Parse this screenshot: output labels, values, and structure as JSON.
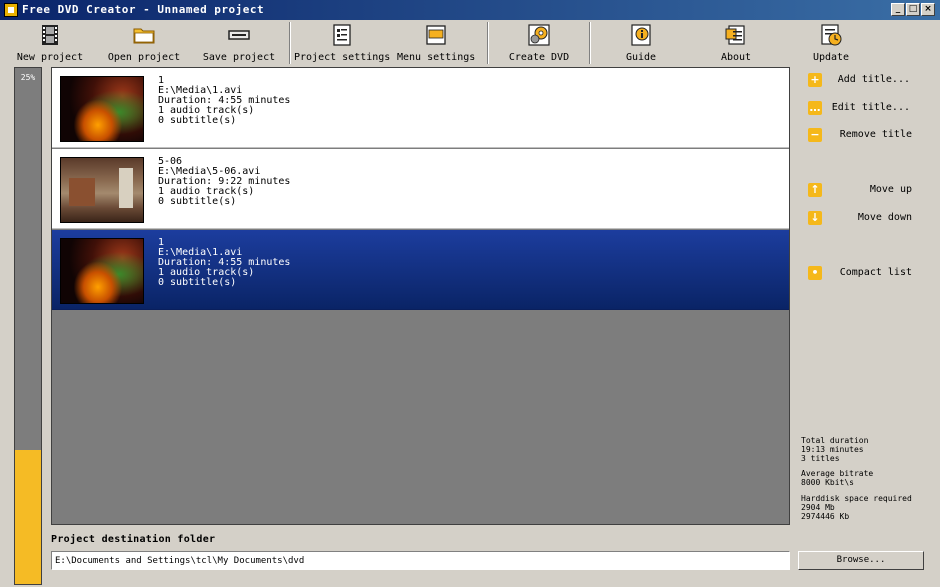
{
  "window": {
    "title": "Free DVD Creator - Unnamed project",
    "controls": [
      "_",
      "□",
      "×"
    ]
  },
  "toolbar": {
    "new_project": "New project",
    "open_project": "Open project",
    "save_project": "Save project",
    "project_settings": "Project settings",
    "menu_settings": "Menu settings",
    "create_dvd": "Create DVD",
    "guide": "Guide",
    "about": "About",
    "update": "Update"
  },
  "progress": {
    "label": "25%",
    "value": 0.26
  },
  "titles": [
    {
      "name": "1",
      "path": "E:\\Media\\1.avi",
      "duration": "Duration: 4:55 minutes",
      "audio": "1 audio track(s)",
      "subs": "0 subtitle(s)",
      "selected": false
    },
    {
      "name": "5-06",
      "path": "E:\\Media\\5-06.avi",
      "duration": "Duration: 9:22 minutes",
      "audio": "1 audio track(s)",
      "subs": "0 subtitle(s)",
      "selected": false
    },
    {
      "name": "1",
      "path": "E:\\Media\\1.avi",
      "duration": "Duration: 4:55 minutes",
      "audio": "1 audio track(s)",
      "subs": "0 subtitle(s)",
      "selected": true
    }
  ],
  "actions": {
    "add_title": "Add title...",
    "edit_title": "Edit title...",
    "remove_title": "Remove title",
    "move_up": "Move up",
    "move_down": "Move down",
    "compact_list": "Compact list"
  },
  "stats": {
    "total_duration_label": "Total duration",
    "total_duration_value": "19:13 minutes",
    "titles_count": "3 titles",
    "avg_bitrate_label": "Average bitrate",
    "avg_bitrate_value": "8000 Kbit\\s",
    "disk_label": "Harddisk space required",
    "disk_mb": "2904 Mb",
    "disk_kb": "2974446 Kb"
  },
  "destination": {
    "label": "Project destination folder",
    "value": "E:\\Documents and Settings\\tcl\\My Documents\\dvd",
    "browse": "Browse..."
  },
  "colors": {
    "accent": "#f5bb25",
    "selection": "#0a2466",
    "list_bg": "#7d7d7d"
  }
}
